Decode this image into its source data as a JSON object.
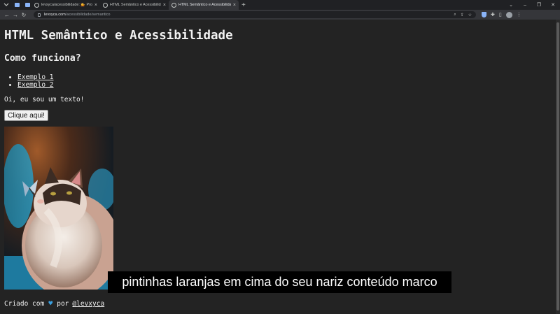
{
  "browser": {
    "tabs": [
      {
        "title": "levxyca/acessibilidade: 💁 Proje",
        "active": false
      },
      {
        "title": "HTML Semântico e Acessibilidade",
        "active": false
      },
      {
        "title": "HTML Semântico e Acessibilidade",
        "active": true
      }
    ],
    "url_host": "levxyca.com",
    "url_path": "/acessibilidade/semantico",
    "icons": [
      "back-icon",
      "forward-icon",
      "reload-icon",
      "lock-icon",
      "zoom-icon",
      "share-icon",
      "star-icon",
      "shield-icon",
      "puzzle-icon",
      "sidepanel-icon",
      "profile-avatar",
      "menu-icon"
    ]
  },
  "page": {
    "title": "HTML Semântico e Acessibilidade",
    "subtitle": "Como funciona?",
    "links": [
      "Exemplo 1",
      "Exemplo 2"
    ],
    "text": "Oi, eu sou um texto!",
    "button_label": "Clique aqui!",
    "image_subject": "cat-with-butterfly",
    "footer_prefix": "Criado com",
    "footer_middle": "por",
    "footer_link": "@levxyca"
  },
  "caption": {
    "text": "pintinhas laranjas em cima do seu nariz conteúdo marco"
  },
  "colors": {
    "page_background": "#232323",
    "heart": "#3aa0e0"
  }
}
